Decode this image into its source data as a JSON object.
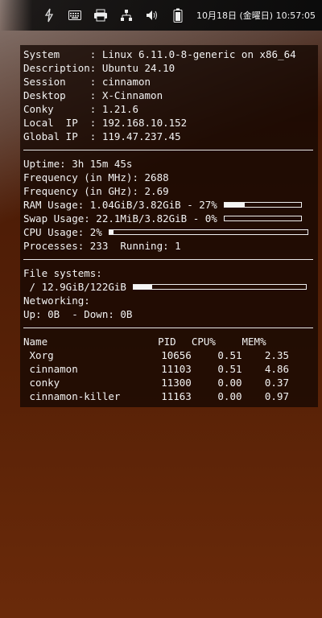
{
  "tray": {
    "icons": [
      "network-transfer-icon",
      "keyboard-icon",
      "printer-icon",
      "network-icon",
      "volume-icon",
      "battery-icon"
    ],
    "clock": "10月18日 (金曜日) 10:57:05"
  },
  "system": [
    {
      "k": "System",
      "v": "Linux 6.11.0-8-generic on x86_64"
    },
    {
      "k": "Description",
      "v": "Ubuntu 24.10"
    },
    {
      "k": "Session",
      "v": "cinnamon"
    },
    {
      "k": "Desktop",
      "v": "X-Cinnamon"
    },
    {
      "k": "Conky",
      "v": "1.21.6"
    },
    {
      "k": "Local  IP",
      "v": "192.168.10.152"
    },
    {
      "k": "Global IP",
      "v": "119.47.237.45"
    }
  ],
  "stats": {
    "uptime": "Uptime: 3h 15m 45s",
    "freq_mhz": "Frequency (in MHz): 2688",
    "freq_ghz": "Frequency (in GHz): 2.69",
    "ram": "RAM Usage: 1.04GiB/3.82GiB - 27%",
    "ram_pct": 27,
    "swap": "Swap Usage: 22.1MiB/3.82GiB - 0%",
    "swap_pct": 0,
    "cpu": "CPU Usage: 2%",
    "cpu_pct": 2,
    "processes": "Processes: 233  Running: 1"
  },
  "fs": {
    "header": "File systems:",
    "root": " / 12.9GiB/122GiB",
    "root_pct": 11,
    "net_header": "Networking:",
    "net": "Up: 0B  - Down: 0B"
  },
  "procs": {
    "headers": [
      "Name",
      "PID",
      "CPU%",
      "MEM%"
    ],
    "rows": [
      [
        " Xorg",
        "10656",
        "0.51",
        "2.35"
      ],
      [
        " cinnamon",
        "11103",
        "0.51",
        "4.86"
      ],
      [
        " conky",
        "11300",
        "0.00",
        "0.37"
      ],
      [
        " cinnamon-killer",
        "11163",
        "0.00",
        "0.97"
      ]
    ]
  }
}
